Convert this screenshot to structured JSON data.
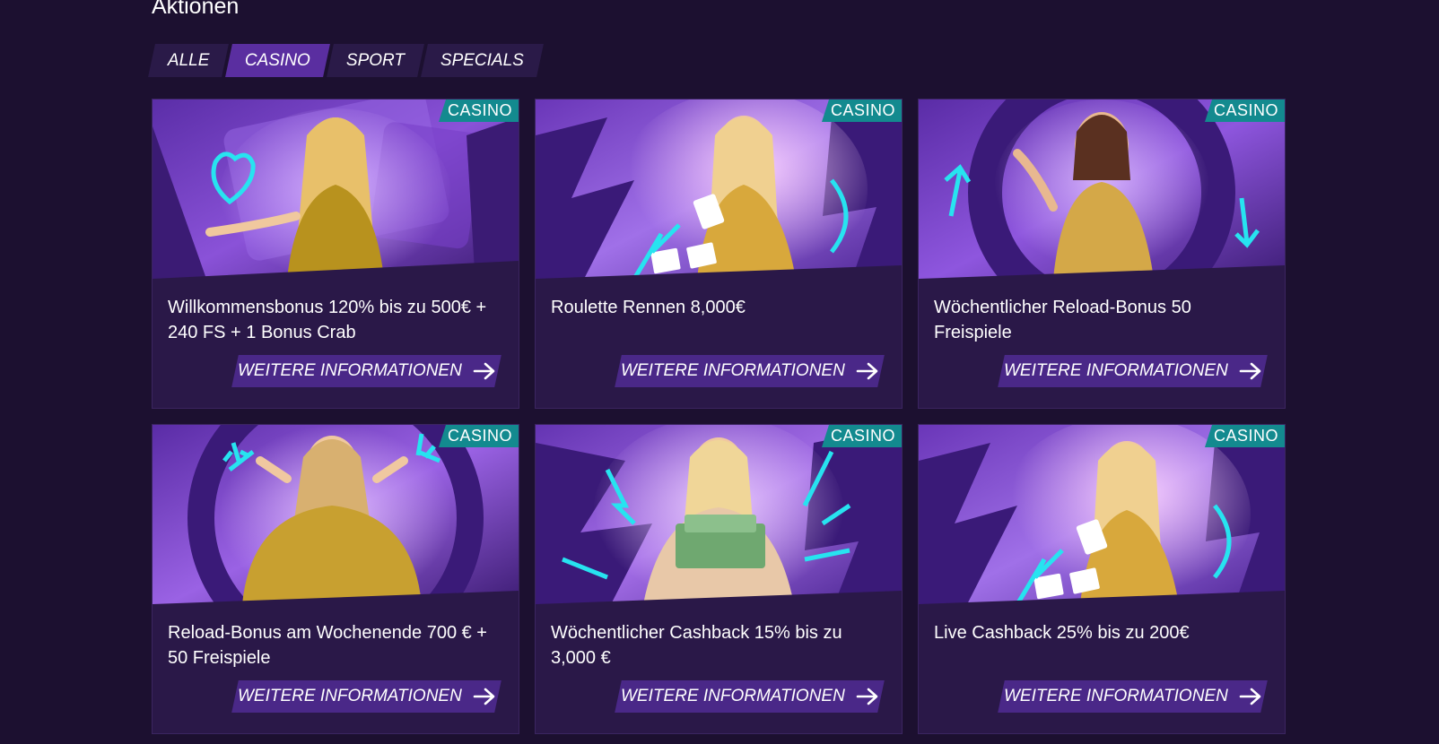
{
  "page": {
    "heading": "Aktionen"
  },
  "tabs": [
    {
      "label": "ALLE",
      "active": false
    },
    {
      "label": "CASINO",
      "active": true
    },
    {
      "label": "SPORT",
      "active": false
    },
    {
      "label": "SPECIALS",
      "active": false
    }
  ],
  "cards": [
    {
      "badge": "CASINO",
      "title": "Willkommensbonus 120% bis zu 500€ + 240 FS + 1 Bonus Crab",
      "button": "WEITERE INFORMATIONEN",
      "accent": "heart-icon"
    },
    {
      "badge": "CASINO",
      "title": "Roulette Rennen 8,000€",
      "button": "WEITERE INFORMATIONEN",
      "accent": "lightning-icon"
    },
    {
      "badge": "CASINO",
      "title": "Wöchentlicher Reload-Bonus 50 Freispiele",
      "button": "WEITERE INFORMATIONEN",
      "accent": "reload-icon"
    },
    {
      "badge": "CASINO",
      "title": "Reload-Bonus am Wochenende 700 € + 50 Freispiele",
      "button": "WEITERE INFORMATIONEN",
      "accent": "spark-icon"
    },
    {
      "badge": "CASINO",
      "title": "Wöchentlicher Cashback 15% bis zu 3,000 €",
      "button": "WEITERE INFORMATIONEN",
      "accent": "lightning-icon"
    },
    {
      "badge": "CASINO",
      "title": "Live Cashback 25% bis zu 200€",
      "button": "WEITERE INFORMATIONEN",
      "accent": "lightning-icon"
    }
  ],
  "colors": {
    "background": "#1c1030",
    "card": "#2a1848",
    "badge": "#138a8f",
    "button": "#4a2888",
    "tab_active": "#5a2ea0",
    "accent_cyan": "#27e3f0"
  }
}
